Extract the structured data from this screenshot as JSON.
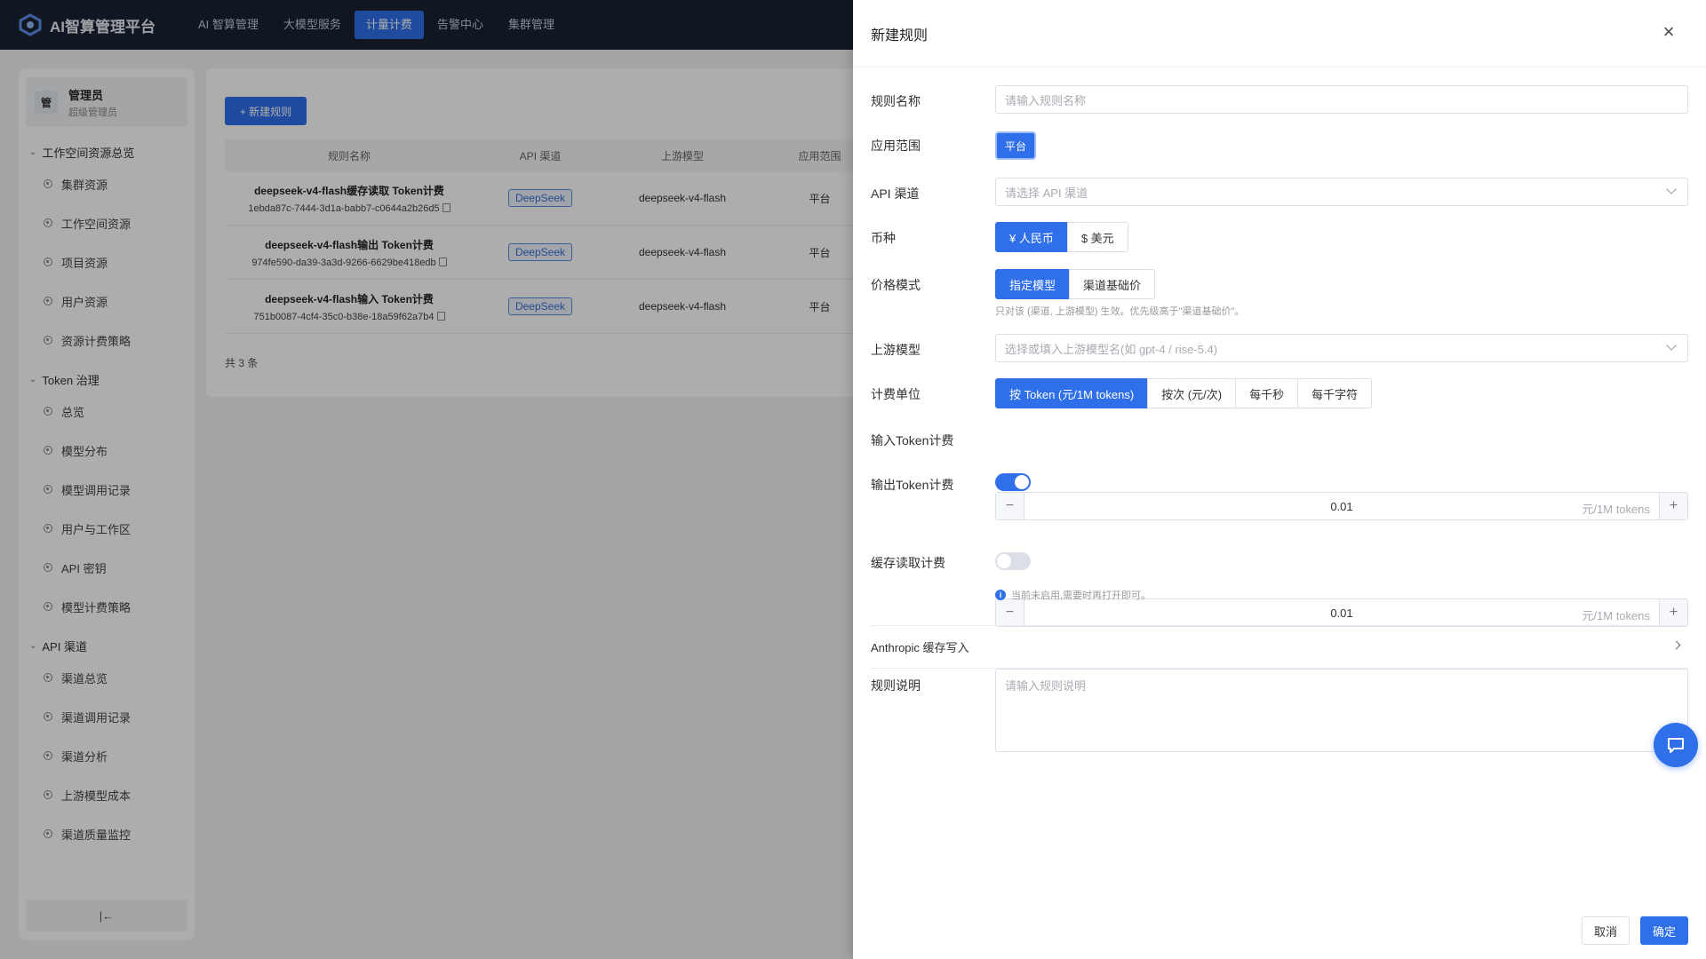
{
  "app": {
    "title": "AI智算管理平台",
    "nav": [
      "AI 智算管理",
      "大模型服务",
      "计量计费",
      "告警中心",
      "集群管理"
    ],
    "nav_active": "计量计费"
  },
  "user": {
    "avatar": "管",
    "name": "管理员",
    "role": "超级管理员"
  },
  "sidebar": {
    "groups": [
      {
        "label": "工作空间资源总览",
        "items": [
          "集群资源",
          "工作空间资源",
          "项目资源",
          "用户资源",
          "资源计费策略"
        ]
      },
      {
        "label": "Token 治理",
        "items": [
          "总览",
          "模型分布",
          "模型调用记录",
          "用户与工作区",
          "API 密钥",
          "模型计费策略"
        ]
      },
      {
        "label": "API 渠道",
        "items": [
          "渠道总览",
          "渠道调用记录",
          "渠道分析",
          "上游模型成本",
          "渠道质量监控"
        ]
      }
    ],
    "collapse_icon": "|←"
  },
  "main": {
    "new_button": "+ 新建规则",
    "table": {
      "headers": [
        "规则名称",
        "API 渠道",
        "上游模型",
        "应用范围"
      ],
      "rows": [
        {
          "name": "deepseek-v4-flash缓存读取 Token计费",
          "id": "1ebda87c-7444-3d1a-babb7-c0644a2b26d5",
          "channel": "DeepSeek",
          "model": "deepseek-v4-flash",
          "scope": "平台"
        },
        {
          "name": "deepseek-v4-flash输出 Token计费",
          "id": "974fe590-da39-3a3d-9266-6629be418edb",
          "channel": "DeepSeek",
          "model": "deepseek-v4-flash",
          "scope": "平台"
        },
        {
          "name": "deepseek-v4-flash输入 Token计费",
          "id": "751b0087-4cf4-35c0-b38e-18a59f62a7b4",
          "channel": "DeepSeek",
          "model": "deepseek-v4-flash",
          "scope": "平台"
        }
      ]
    },
    "total": "共 3 条"
  },
  "drawer": {
    "title": "新建规则",
    "close": "×",
    "fields": {
      "rule_name": {
        "label": "规则名称",
        "placeholder": "请输入规则名称"
      },
      "scope": {
        "label": "应用范围",
        "value": "平台"
      },
      "api_channel": {
        "label": "API 渠道",
        "placeholder": "请选择 API 渠道"
      },
      "currency": {
        "label": "币种",
        "options": [
          "¥ 人民币",
          "$ 美元"
        ],
        "selected": 0
      },
      "price_mode": {
        "label": "价格模式",
        "options": [
          "指定模型",
          "渠道基础价"
        ],
        "selected": 0,
        "hint": "只对该 (渠道, 上游模型) 生效。优先级高于\"渠道基础价\"。"
      },
      "upstream_model": {
        "label": "上游模型",
        "placeholder": "选择或填入上游模型名(如 gpt-4 / rise-5.4)"
      },
      "billing_unit": {
        "label": "计费单位",
        "options": [
          "按 Token (元/1M tokens)",
          "按次 (元/次)",
          "每千秒",
          "每千字符"
        ],
        "selected": 0
      },
      "input_token": {
        "label": "输入Token计费",
        "value": "0.01",
        "unit": "元/1M tokens",
        "minus": "−",
        "plus": "+"
      },
      "output_token": {
        "label": "输出Token计费",
        "enabled": true,
        "value": "0.01",
        "unit": "元/1M tokens",
        "minus": "−",
        "plus": "+"
      },
      "cache_read": {
        "label": "缓存读取计费",
        "enabled": false,
        "hint": "当前未启用,需要时再打开即可。"
      },
      "anthropic": {
        "label": "Anthropic 缓存写入"
      },
      "description": {
        "label": "规则说明",
        "placeholder": "请输入规则说明"
      }
    },
    "cancel": "取消",
    "confirm": "确定"
  },
  "colors": {
    "primary": "#2f6fe9",
    "topbar": "#1a2233"
  }
}
